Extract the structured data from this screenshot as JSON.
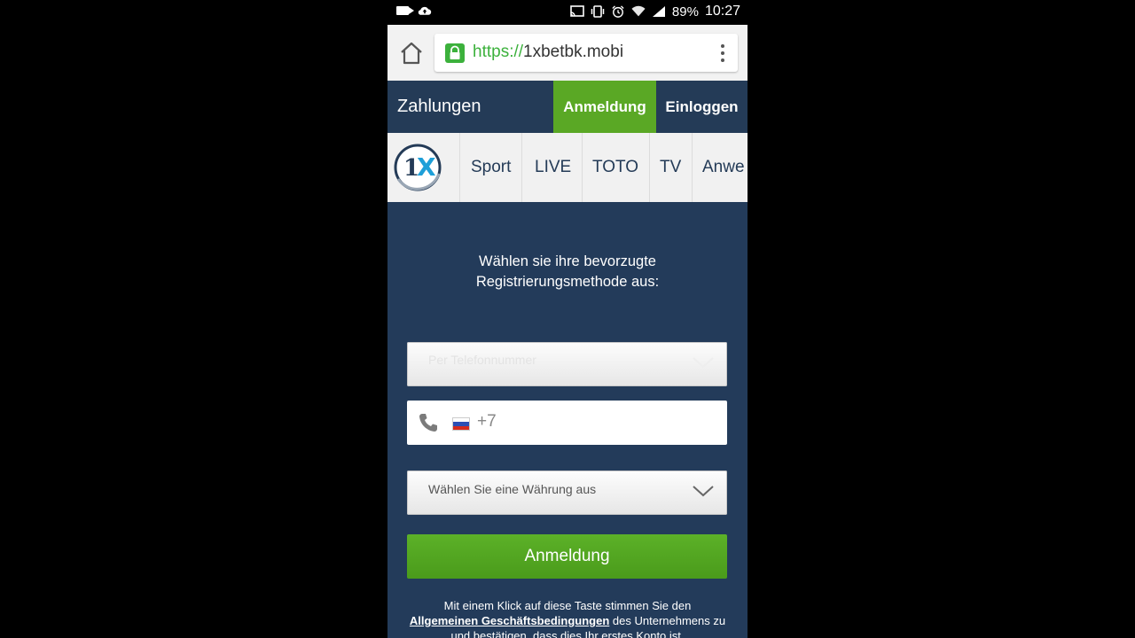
{
  "status_bar": {
    "battery": "89%",
    "time": "10:27",
    "icons": [
      "video-camera-icon",
      "cloud-upload-icon",
      "cast-icon",
      "vibrate-icon",
      "alarm-icon",
      "wifi-icon",
      "signal-icon"
    ]
  },
  "browser": {
    "url_scheme": "https://",
    "url_host": "1xbetbk.mobi"
  },
  "top_nav": {
    "payments": "Zahlungen",
    "register": "Anmeldung",
    "login": "Einloggen"
  },
  "sub_nav": {
    "logo_text": "1X",
    "items": [
      "Sport",
      "LIVE",
      "TOTO",
      "TV",
      "Anwe"
    ]
  },
  "form": {
    "headline_line1": "Wählen sie ihre bevorzugte",
    "headline_line2": "Registrierungsmethode aus:",
    "method_placeholder": "Per Telefonnummer",
    "phone_code": "+7",
    "currency_placeholder": "Wählen Sie eine Währung aus",
    "submit_label": "Anmeldung",
    "terms_prefix": "Mit einem Klick auf diese Taste stimmen Sie den",
    "terms_link": "Allgemeinen Geschäftsbedingungen",
    "terms_middle": "des Unternehmens zu",
    "terms_suffix": "und bestätigen, dass dies Ihr erstes Konto ist."
  },
  "colors": {
    "header_bg": "#243b57",
    "accent_green": "#5aa825",
    "url_green": "#3cb13c",
    "main_bg": "#233b5a"
  }
}
